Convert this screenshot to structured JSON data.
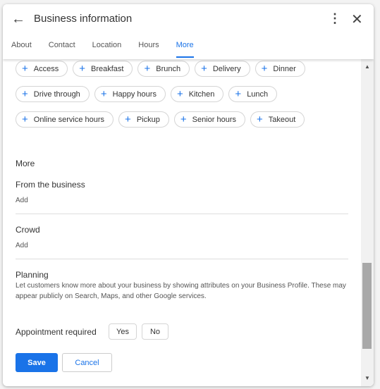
{
  "header": {
    "title": "Business information"
  },
  "tabs": [
    {
      "label": "About"
    },
    {
      "label": "Contact"
    },
    {
      "label": "Location"
    },
    {
      "label": "Hours"
    },
    {
      "label": "More",
      "active": true
    }
  ],
  "chip_rows": [
    [
      "Access",
      "Breakfast",
      "Brunch",
      "Delivery",
      "Dinner"
    ],
    [
      "Drive through",
      "Happy hours",
      "Kitchen",
      "Lunch"
    ],
    [
      "Online service hours",
      "Pickup",
      "Senior hours",
      "Takeout"
    ]
  ],
  "more": {
    "heading": "More",
    "from_business": "From the business",
    "from_business_add": "Add",
    "crowd": "Crowd",
    "crowd_add": "Add",
    "planning": "Planning",
    "planning_desc": "Let customers know more about your business by showing attributes on your Business Profile. These may appear publicly on Search, Maps, and other Google services.",
    "appointment_label": "Appointment required",
    "yes": "Yes",
    "no": "No"
  },
  "actions": {
    "save": "Save",
    "cancel": "Cancel"
  },
  "colors": {
    "accent": "#1a73e8"
  },
  "scroll": {
    "position_percent": 75
  }
}
